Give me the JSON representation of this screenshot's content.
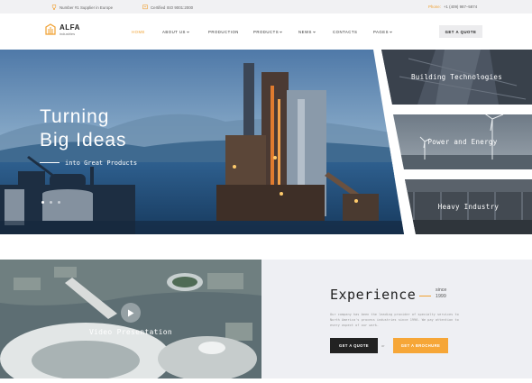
{
  "topbar": {
    "supplier_text": "Number #1 Supplier in Europe",
    "certified_text": "Certified ISO 9001:2000",
    "phone_label": "Phone:",
    "phone_number": "+1 (409) 987–5874"
  },
  "header": {
    "logo_name": "ALFA",
    "logo_sub": "industries",
    "nav": [
      {
        "label": "HOME",
        "active": true
      },
      {
        "label": "ABOUT US",
        "dropdown": true
      },
      {
        "label": "PRODUCTION"
      },
      {
        "label": "PRODUCTS",
        "dropdown": true
      },
      {
        "label": "NEWS",
        "dropdown": true
      },
      {
        "label": "CONTACTS"
      },
      {
        "label": "PAGES",
        "dropdown": true
      }
    ],
    "quote_button": "GET A QUOTE"
  },
  "hero": {
    "title_line1": "Turning",
    "title_line2": "Big Ideas",
    "subtitle": "into Great Products",
    "slides": 3,
    "active_slide": 1
  },
  "cards": [
    {
      "label": "Building Technologies"
    },
    {
      "label": "Power and Energy"
    },
    {
      "label": "Heavy Industry"
    }
  ],
  "video": {
    "label": "Video Presentation"
  },
  "experience": {
    "title": "Experience",
    "since_line1": "since",
    "since_line2": "1999",
    "text": "Our company has been the leading provider of specialty services to North America's process industries since 1996. We pay attention to every aspect of our work.",
    "quote_button": "GET A QUOTE",
    "or_text": "or",
    "brochure_button": "GET A BROCHURE"
  },
  "colors": {
    "accent": "#f0a030",
    "dark": "#222222",
    "light_bg": "#eeeff3"
  }
}
